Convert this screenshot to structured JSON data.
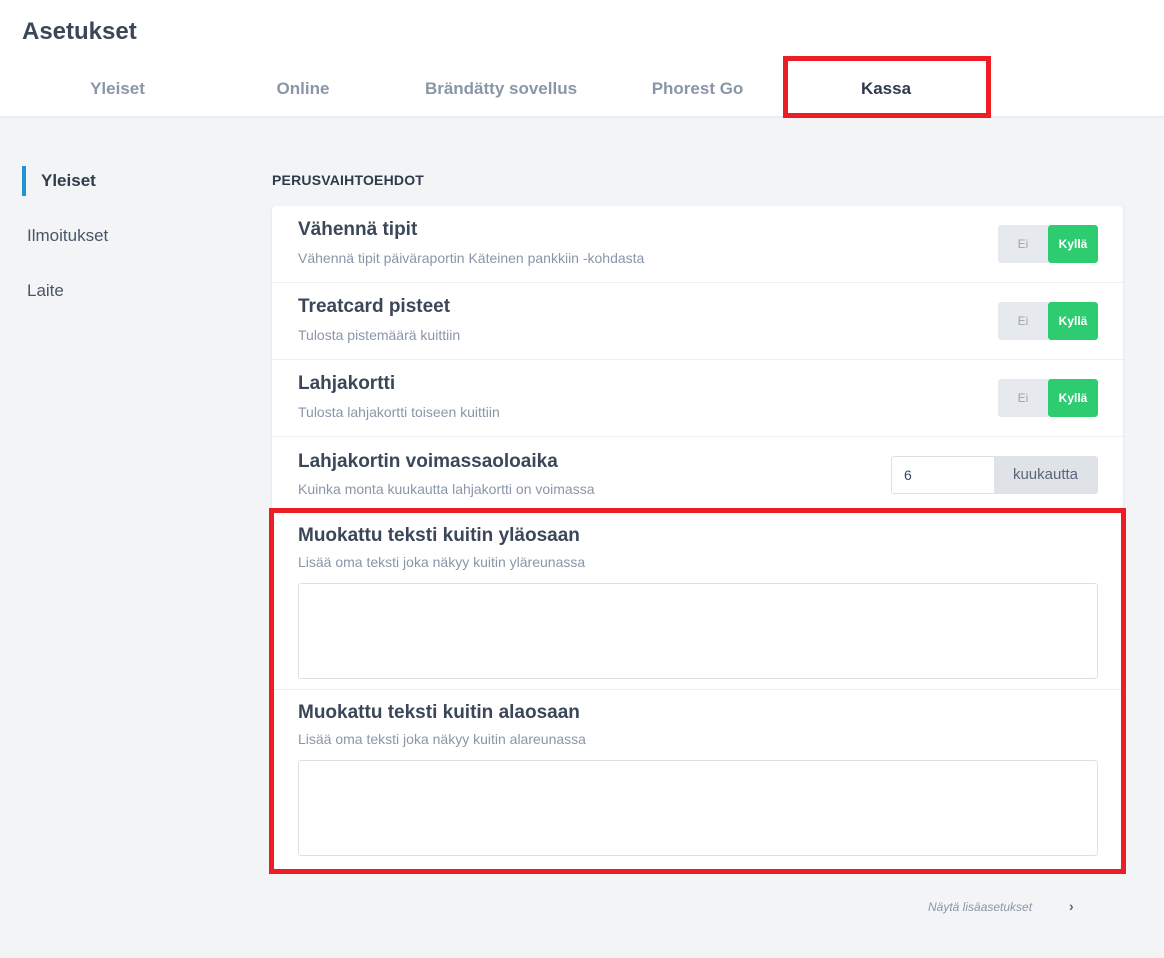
{
  "header": {
    "title": "Asetukset",
    "tabs": [
      {
        "label": "Yleiset",
        "active": false
      },
      {
        "label": "Online",
        "active": false
      },
      {
        "label": "Brändätty sovellus",
        "active": false
      },
      {
        "label": "Phorest Go",
        "active": false
      },
      {
        "label": "Kassa",
        "active": true
      }
    ]
  },
  "sidebar": {
    "items": [
      {
        "label": "Yleiset",
        "active": true
      },
      {
        "label": "Ilmoitukset",
        "active": false
      },
      {
        "label": "Laite",
        "active": false
      }
    ]
  },
  "main": {
    "section_heading": "PERUSVAIHTOEHDOT",
    "settings": [
      {
        "title": "Vähennä tipit",
        "description": "Vähennä tipit päiväraportin Käteinen pankkiin -kohdasta",
        "off_label": "Ei",
        "on_label": "Kyllä",
        "value": "Kyllä"
      },
      {
        "title": "Treatcard pisteet",
        "description": "Tulosta pistemäärä kuittiin",
        "off_label": "Ei",
        "on_label": "Kyllä",
        "value": "Kyllä"
      },
      {
        "title": "Lahjakortti",
        "description": "Tulosta lahjakortti toiseen kuittiin",
        "off_label": "Ei",
        "on_label": "Kyllä",
        "value": "Kyllä"
      }
    ],
    "validity": {
      "title": "Lahjakortin voimassaoloaika",
      "description": "Kuinka monta kuukautta lahjakortti on voimassa",
      "value": "6",
      "unit": "kuukautta"
    },
    "receipt_header": {
      "title": "Muokattu teksti kuitin yläosaan",
      "description": "Lisää oma teksti joka näkyy kuitin yläreunassa",
      "value": ""
    },
    "receipt_footer": {
      "title": "Muokattu teksti kuitin alaosaan",
      "description": "Lisää oma teksti joka näkyy kuitin alareunassa",
      "value": ""
    },
    "more_link": "Näytä lisäasetukset",
    "more_icon": "chevron-right-icon"
  },
  "colors": {
    "accent": "#1f93d3",
    "toggle_on": "#2ecc71",
    "highlight": "#ee1c25"
  }
}
